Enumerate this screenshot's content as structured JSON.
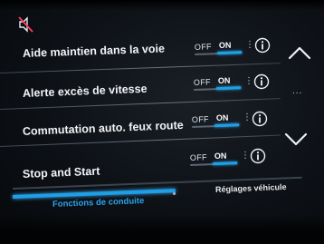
{
  "header": {
    "mute_icon": "speaker-muted-icon"
  },
  "settings": [
    {
      "label": "Aide maintien dans la voie",
      "off_label": "OFF",
      "on_label": "ON",
      "state": "on",
      "info_icon": "info-icon"
    },
    {
      "label": "Alerte excès de vitesse",
      "off_label": "OFF",
      "on_label": "ON",
      "state": "on",
      "info_icon": "info-icon"
    },
    {
      "label": "Commutation auto. feux route",
      "off_label": "OFF",
      "on_label": "ON",
      "state": "on",
      "info_icon": "info-icon"
    },
    {
      "label": "Stop and Start",
      "off_label": "OFF",
      "on_label": "ON",
      "state": "on",
      "info_icon": "info-icon"
    }
  ],
  "scroll": {
    "up_icon": "chevron-up-icon",
    "down_icon": "chevron-down-icon",
    "more_label": "..."
  },
  "tabs": [
    {
      "label": "Fonctions de conduite",
      "active": true
    },
    {
      "label": "Réglages véhicule",
      "active": false
    }
  ],
  "colors": {
    "accent": "#1e9fe6",
    "text": "#f2f4f7",
    "background": "#0d1116"
  }
}
